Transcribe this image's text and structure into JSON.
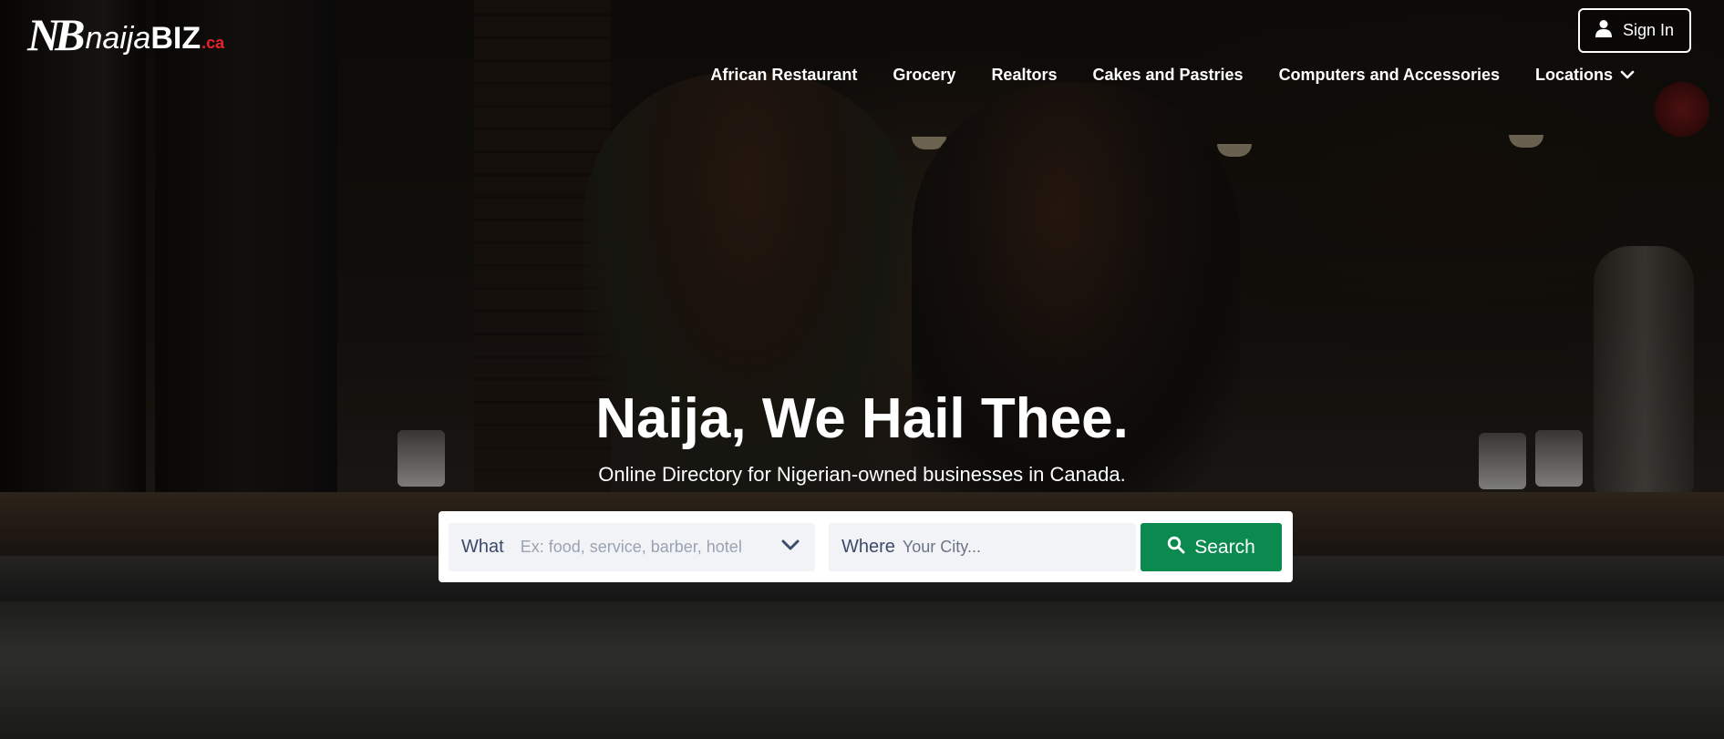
{
  "brand": {
    "mark": "NB",
    "word_regular": "naija",
    "word_bold": "BIZ",
    "tld": ".ca",
    "tld_color": "#e8222b"
  },
  "header": {
    "signin": {
      "label": "Sign In",
      "icon": "user-icon"
    }
  },
  "nav": {
    "items": [
      {
        "label": "African Restaurant"
      },
      {
        "label": "Grocery"
      },
      {
        "label": "Realtors"
      },
      {
        "label": "Cakes and Pastries"
      },
      {
        "label": "Computers and Accessories"
      },
      {
        "label": "Locations",
        "icon": "chevron-down-icon"
      }
    ]
  },
  "hero": {
    "headline": "Naija, We Hail Thee.",
    "subline": "Online Directory for Nigerian-owned businesses in Canada."
  },
  "search": {
    "what_label": "What",
    "what_placeholder": "Ex: food, service, barber, hotel",
    "what_value": "",
    "what_dropdown_icon": "chevron-down-icon",
    "where_label": "Where",
    "where_placeholder": "Your City...",
    "where_value": "",
    "button_label": "Search",
    "button_icon": "search-icon",
    "button_color": "#0a8a4f"
  }
}
